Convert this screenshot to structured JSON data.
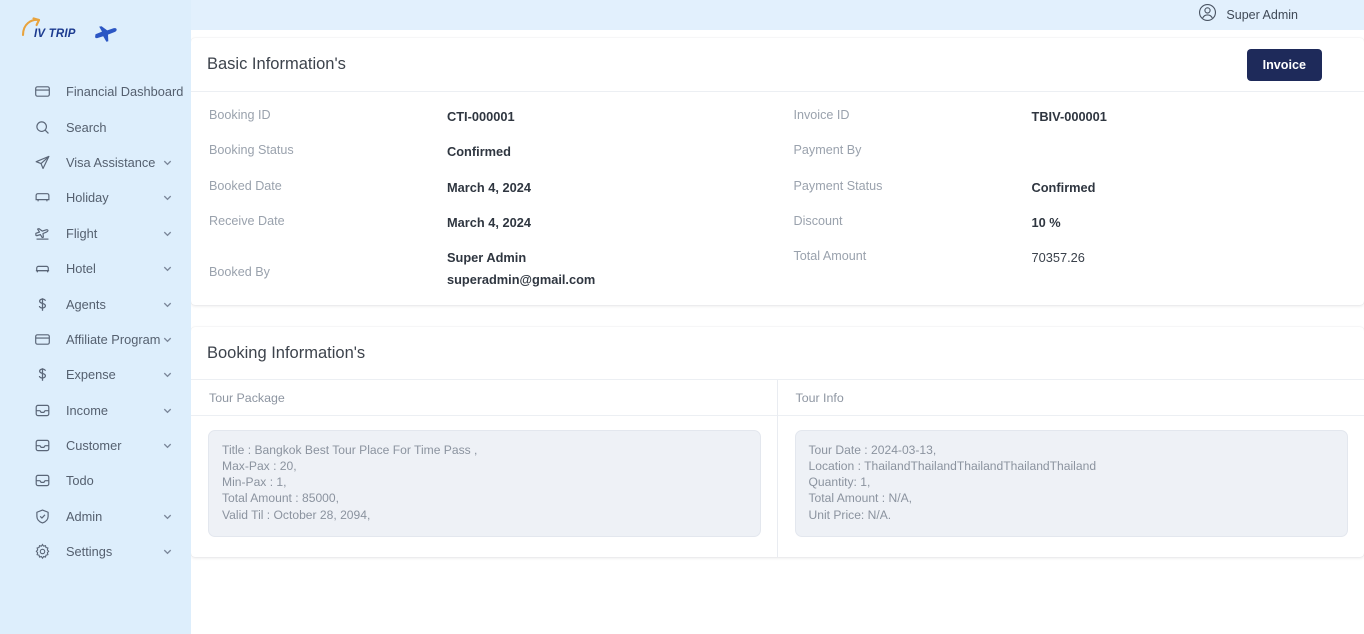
{
  "brand": {
    "text": "IV TRIP",
    "arrow_icon": "curved-arrow-icon",
    "plane_icon": "airplane-icon",
    "accent_orange": "#e8a33d",
    "accent_blue": "#2b56c4"
  },
  "topbar": {
    "user_name": "Super Admin",
    "user_icon": "user-circle-icon",
    "background": "#e2f0fd"
  },
  "sidebar": {
    "background": "#ddeefc",
    "items": [
      {
        "label": "Financial Dashboard",
        "icon": "credit-card-icon",
        "has_chevron": false
      },
      {
        "label": "Search",
        "icon": "search-icon",
        "has_chevron": false
      },
      {
        "label": "Visa Assistance",
        "icon": "paper-plane-icon",
        "has_chevron": true
      },
      {
        "label": "Holiday",
        "icon": "bus-icon",
        "has_chevron": true
      },
      {
        "label": "Flight",
        "icon": "flight-takeoff-icon",
        "has_chevron": true
      },
      {
        "label": "Hotel",
        "icon": "bed-icon",
        "has_chevron": true
      },
      {
        "label": "Agents",
        "icon": "dollar-icon",
        "has_chevron": true
      },
      {
        "label": "Affiliate Program",
        "icon": "credit-card-icon",
        "has_chevron": true
      },
      {
        "label": "Expense",
        "icon": "dollar-icon",
        "has_chevron": true
      },
      {
        "label": "Income",
        "icon": "inbox-icon",
        "has_chevron": true
      },
      {
        "label": "Customer",
        "icon": "inbox-icon",
        "has_chevron": true
      },
      {
        "label": "Todo",
        "icon": "inbox-icon",
        "has_chevron": false
      },
      {
        "label": "Admin",
        "icon": "shield-check-icon",
        "has_chevron": true
      },
      {
        "label": "Settings",
        "icon": "gear-icon",
        "has_chevron": true
      }
    ]
  },
  "basic_information": {
    "title": "Basic Information's",
    "invoice_button": "Invoice",
    "invoice_button_color": "#1e2a5a",
    "left_fields": [
      {
        "label": "Booking ID",
        "value": "CTI-000001"
      },
      {
        "label": "Booking Status",
        "value": "Confirmed"
      },
      {
        "label": "Booked Date",
        "value": "March 4, 2024"
      },
      {
        "label": "Receive Date",
        "value": "March 4, 2024"
      }
    ],
    "booked_by": {
      "label": "Booked By",
      "name": "Super Admin",
      "email": "superadmin@gmail.com"
    },
    "right_fields": [
      {
        "label": "Invoice ID",
        "value": "TBIV-000001"
      },
      {
        "label": "Payment By",
        "value": ""
      },
      {
        "label": "Payment Status",
        "value": "Confirmed"
      },
      {
        "label": "Discount",
        "value": "10 %"
      },
      {
        "label": "Total Amount",
        "value": "70357.26"
      }
    ]
  },
  "booking_information": {
    "title": "Booking Information's",
    "tour_package": {
      "header": "Tour Package",
      "lines": [
        "Title : Bangkok Best Tour Place For Time Pass ,",
        "Max-Pax : 20,",
        "Min-Pax : 1,",
        "Total Amount : 85000,",
        "Valid Til : October 28, 2094,"
      ]
    },
    "tour_info": {
      "header": "Tour Info",
      "lines": [
        "Tour Date : 2024-03-13,",
        "Location : ThailandThailandThailandThailandThailand",
        "Quantity: 1,",
        "Total Amount : N/A,",
        "Unit Price: N/A."
      ]
    }
  }
}
